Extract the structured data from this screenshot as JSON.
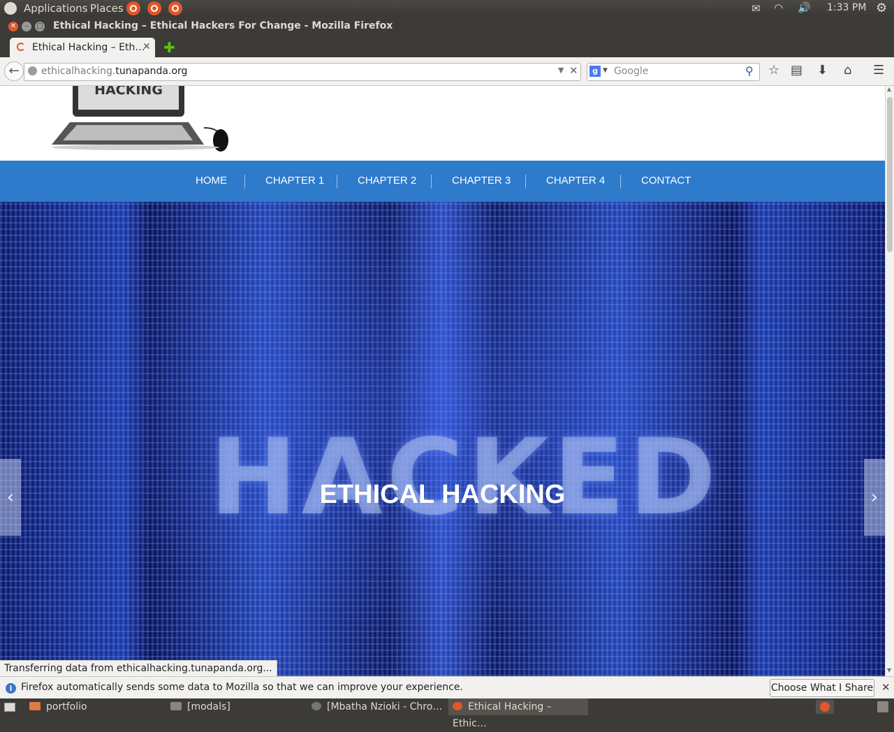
{
  "top_panel": {
    "applications": "Applications",
    "places": "Places",
    "clock": "1:33 PM"
  },
  "window": {
    "title": "Ethical Hacking – Ethical Hackers For Change - Mozilla Firefox"
  },
  "tab": {
    "label": "Ethical Hacking – Eth…",
    "close": "✕",
    "new_tab": "✚"
  },
  "navbar": {
    "url_domain_prefix": "ethicalhacking.",
    "url_domain_main": "tunapanda.org",
    "search_placeholder": "Google"
  },
  "site": {
    "logo_text": "HACKING",
    "menu": [
      "HOME",
      "CHAPTER 1",
      "CHAPTER 2",
      "CHAPTER 3",
      "CHAPTER 4",
      "CONTACT"
    ],
    "hero_background_text": "HACKED",
    "hero_title": "ETHICAL HACKING"
  },
  "status_bar": "Transferring data from ethicalhacking.tunapanda.org...",
  "notification": {
    "message": "Firefox automatically sends some data to Mozilla so that we can improve your experience.",
    "button": "Choose What I Share"
  },
  "taskbar": {
    "items": [
      "portfolio",
      "[modals]",
      "[Mbatha Nzioki - Chro…",
      "Ethical Hacking – Ethic…"
    ]
  },
  "colors": {
    "nav_blue": "#2e7acb",
    "ubuntu_orange": "#e2562b"
  }
}
